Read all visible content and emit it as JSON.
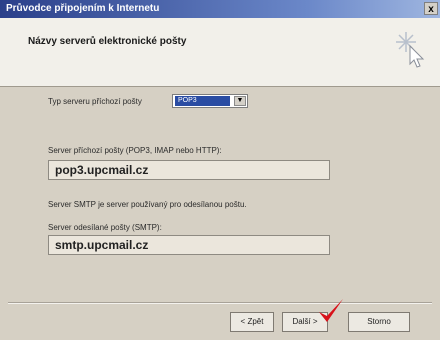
{
  "window": {
    "title": "Průvodce připojením k Internetu",
    "close_glyph": "x"
  },
  "header": {
    "heading": "Názvy serverů elektronické pošty",
    "icon": "wizard-icon"
  },
  "incoming_type": {
    "label": "Typ serveru příchozí pošty",
    "value": "POP3"
  },
  "incoming_server": {
    "label": "Server příchozí pošty (POP3, IMAP nebo HTTP):",
    "value": "pop3.upcmail.cz"
  },
  "smtp_info": "Server SMTP je server používaný pro odesílanou poštu.",
  "outgoing_server": {
    "label": "Server odesílané pošty (SMTP):",
    "value": "smtp.upcmail.cz"
  },
  "buttons": {
    "back": "< Zpět",
    "next": "Další >",
    "cancel": "Storno"
  },
  "colors": {
    "titlebar": "#2a3f8a",
    "checkmark": "#d8111a"
  }
}
